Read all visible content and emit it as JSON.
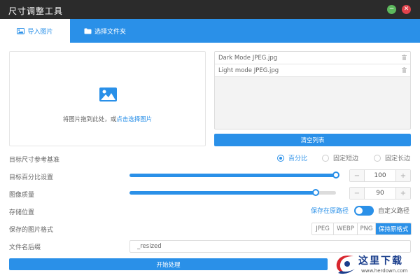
{
  "window": {
    "title": "尺寸调整工具",
    "min_symbol": "−",
    "close_symbol": "✕"
  },
  "tabs": [
    {
      "label": "导入图片",
      "icon": "image-icon",
      "active": true
    },
    {
      "label": "选择文件夹",
      "icon": "folder-icon",
      "active": false
    }
  ],
  "dropzone": {
    "hint_text": "将图片拖到此处，或",
    "hint_link": "点击选择图片",
    "icon": "image-icon"
  },
  "file_list": {
    "items": [
      {
        "name": "Dark Mode JPEG.jpg"
      },
      {
        "name": "Light mode JPEG.jpg"
      }
    ],
    "clear_label": "清空列表"
  },
  "target_basis": {
    "label": "目标尺寸参考基准",
    "options": [
      {
        "label": "百分比",
        "checked": true
      },
      {
        "label": "固定短边",
        "checked": false
      },
      {
        "label": "固定长边",
        "checked": false
      }
    ]
  },
  "percent": {
    "label": "目标百分比设置",
    "value": "100",
    "fraction": 1.0
  },
  "quality": {
    "label": "图像质量",
    "value": "90",
    "fraction": 0.9
  },
  "stepper": {
    "minus": "−",
    "plus": "+"
  },
  "storage": {
    "label": "存储位置",
    "option_original": "保存在原路径",
    "option_custom": "自定义路径",
    "toggle_on": true
  },
  "format": {
    "label": "保存的图片格式",
    "options": [
      {
        "label": "JPEG",
        "active": false
      },
      {
        "label": "WEBP",
        "active": false
      },
      {
        "label": "PNG",
        "active": false
      },
      {
        "label": "保持原格式",
        "active": true
      }
    ]
  },
  "suffix": {
    "label": "文件名后缀",
    "value": "_resized"
  },
  "start_label": "开始处理",
  "watermark": {
    "text": "这里下载",
    "url": "www.herdown.com"
  },
  "colors": {
    "accent": "#2a90e8",
    "titlebar": "#2b2b2b",
    "minimize": "#5cb85c",
    "close": "#e0424b"
  }
}
